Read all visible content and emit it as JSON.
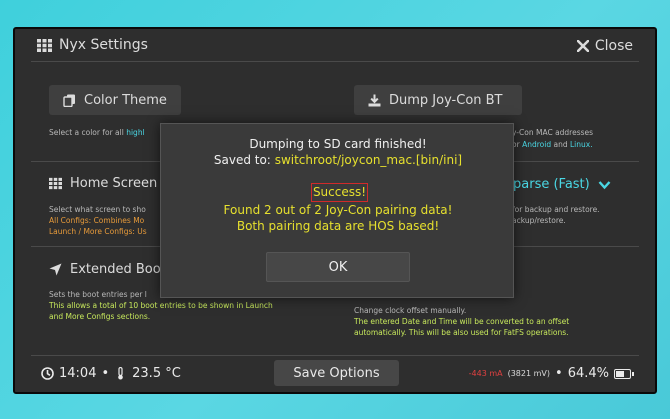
{
  "header": {
    "title": "Nyx Settings",
    "close_label": "Close"
  },
  "buttons": {
    "color_theme": "Color Theme",
    "dump_joycon": "Dump Joy-Con BT"
  },
  "descriptions": {
    "color_a": "Select a color for all",
    "color_b": "highl",
    "joycon_a": "y-Con MAC addresses",
    "joycon_b_pre": "or",
    "joycon_b_android": "Android",
    "joycon_b_and": "and",
    "joycon_b_linux": "Linux.",
    "home_a": "Select what screen to sho",
    "home_b": "All Configs: Combines Mo",
    "home_c": "Launch / More Configs: Us",
    "sparse_a": "for backup and restore.",
    "sparse_b": "ackup/restore.",
    "boot_a": "Sets the boot entries per l",
    "boot_b": "This allows a total of 10 boot entries to be shown in Launch",
    "boot_c": "and More Configs sections.",
    "clock_a": "Change clock offset manually.",
    "clock_b": "The entered Date and Time will be converted to an offset",
    "clock_c": "automatically. This will be also used for FatFS operations."
  },
  "sections": {
    "home_screen": "Home Screen",
    "extended_boot": "Extended Boot",
    "sparse_value": "parse (Fast)"
  },
  "modal": {
    "line1": "Dumping to SD card finished!",
    "line2_prefix": "Saved to:",
    "line2_path": "switchroot/joycon_mac.[bin/ini]",
    "success": "Success!",
    "line4": "Found 2 out of 2 Joy-Con pairing data!",
    "line5": "Both pairing data are HOS based!",
    "ok_label": "OK"
  },
  "footer": {
    "time": "14:04",
    "temperature": "23.5 °C",
    "save_label": "Save Options",
    "current": "-443 mA",
    "voltage": "(3821 mV)",
    "battery_percent": "64.4%",
    "battery_level": 0.644,
    "separator": "•"
  },
  "icons": {
    "header": "grid-icon",
    "close": "close-icon",
    "color_theme": "copy-icon",
    "dump": "download-icon",
    "home": "grid-icon",
    "boot": "navigation-icon",
    "sparse": "chevron-down-icon",
    "clock": "clock-icon",
    "temp": "thermometer-icon",
    "battery": "battery-icon"
  },
  "colors": {
    "accent": "#4ad7e4",
    "highlight": "#e6e02e",
    "warning": "#e04040",
    "orange": "#e69a3a",
    "green": "#c7e85c"
  }
}
